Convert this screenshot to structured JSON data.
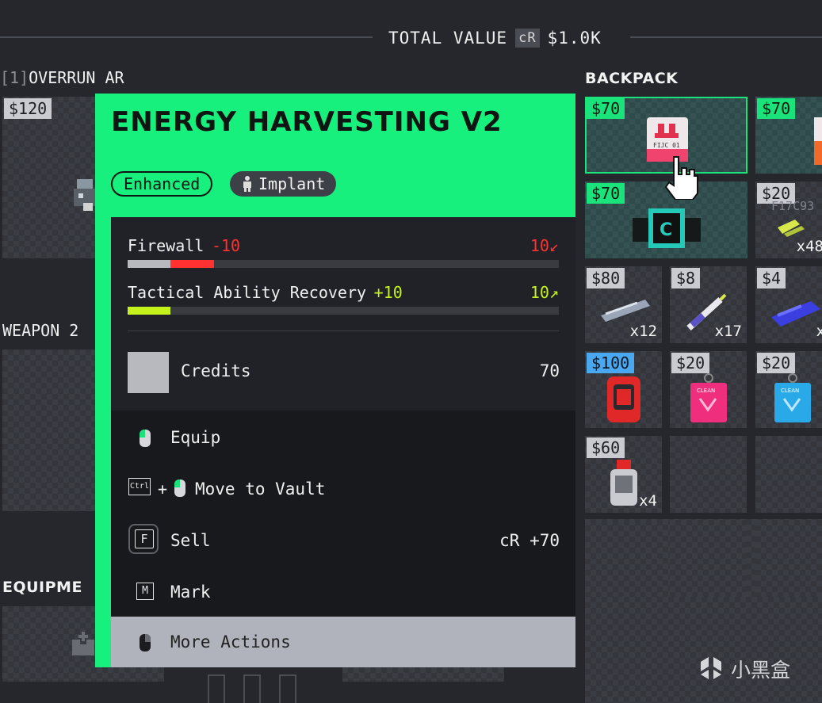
{
  "header": {
    "total_label": "TOTAL VALUE",
    "currency": "cR",
    "total_value": "$1.0K"
  },
  "left": {
    "slot1_num": "[1]",
    "slot1_name": "OVERRUN AR",
    "slot1_price": "$120",
    "weapon2_label": "WEAPON 2",
    "equipment_label": "EQUIPME"
  },
  "backpack": {
    "title": "BACKPACK",
    "items": [
      {
        "price": "$70",
        "qty": "",
        "label": "FIJC 01"
      },
      {
        "price": "$70",
        "qty": ""
      },
      {
        "price": "$70",
        "qty": ""
      },
      {
        "price": "$20",
        "qty": "x48",
        "label": "F17C93"
      },
      {
        "price": "$80",
        "qty": "x12"
      },
      {
        "price": "$8",
        "qty": "x17"
      },
      {
        "price": "$4",
        "qty": "x"
      },
      {
        "price": "$100",
        "qty": ""
      },
      {
        "price": "$20",
        "qty": "",
        "label": "CLEAN"
      },
      {
        "price": "$20",
        "qty": "",
        "label": "CLEAN"
      },
      {
        "price": "$60",
        "qty": "x4"
      }
    ]
  },
  "tooltip": {
    "title": "ENERGY HARVESTING V2",
    "tags": [
      "Enhanced",
      "Implant"
    ],
    "stats": [
      {
        "name": "Firewall",
        "delta": "-10",
        "value": "10",
        "arrow": "↙",
        "fill": 0.2,
        "base": 0.1
      },
      {
        "name": "Tactical Ability Recovery",
        "delta": "+10",
        "value": "10",
        "arrow": "↗",
        "fill": 0.1,
        "base": 0
      }
    ],
    "credits_label": "Credits",
    "credits_value": "70",
    "actions": [
      {
        "label": "Equip",
        "key": "mouse-left",
        "value": ""
      },
      {
        "label": "Move to Vault",
        "key": "Ctrl",
        "plus": "+",
        "value": ""
      },
      {
        "label": "Sell",
        "key": "F",
        "value": "cR +70"
      },
      {
        "label": "Mark",
        "key": "M",
        "value": ""
      },
      {
        "label": "More Actions",
        "key": "mouse-right",
        "value": ""
      }
    ]
  },
  "watermark": "小黑盒",
  "colors": {
    "accent": "#17f07d",
    "negative": "#ff3131",
    "positive": "#c6f21c"
  }
}
